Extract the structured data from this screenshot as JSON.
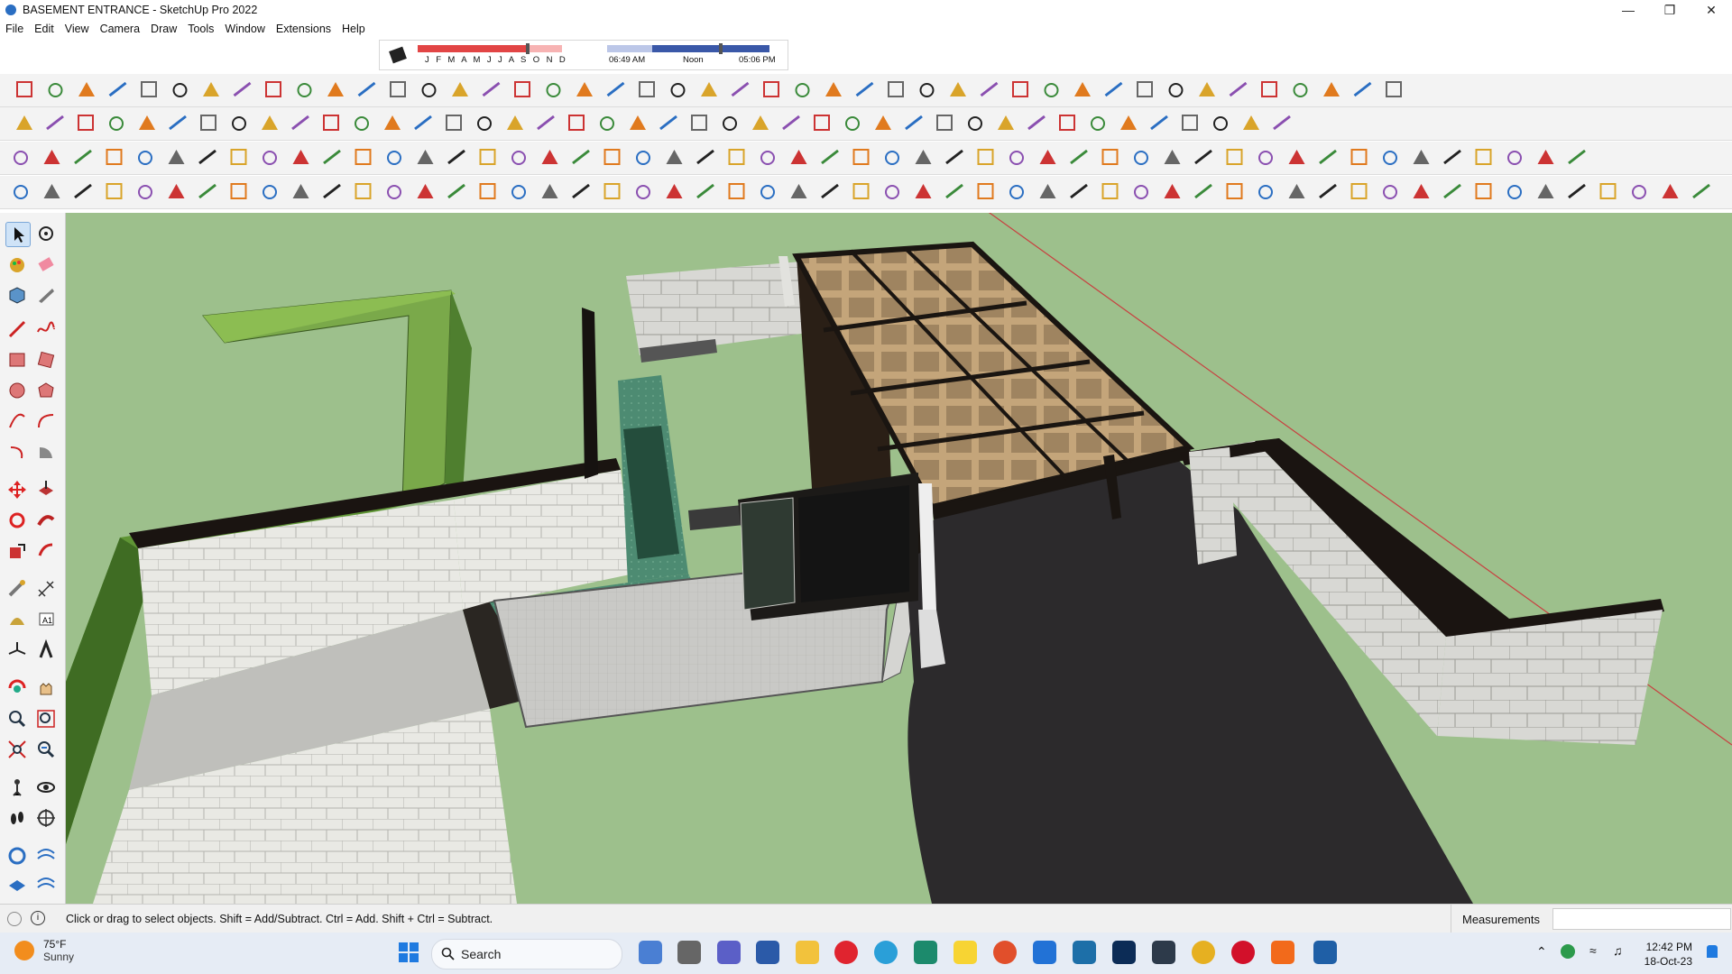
{
  "window": {
    "title": "BASEMENT ENTRANCE - SketchUp Pro 2022"
  },
  "menu": [
    "File",
    "Edit",
    "View",
    "Camera",
    "Draw",
    "Tools",
    "Window",
    "Extensions",
    "Help"
  ],
  "shadow": {
    "months": "J F M A M J J A S O N D",
    "time_start": "06:49 AM",
    "time_noon": "Noon",
    "time_end": "05:06 PM"
  },
  "status": {
    "hint": "Click or drag to select objects. Shift = Add/Subtract. Ctrl = Add. Shift + Ctrl = Subtract.",
    "measurements_label": "Measurements",
    "measurements_value": ""
  },
  "taskbar": {
    "weather_temp": "75°F",
    "weather_desc": "Sunny",
    "search_label": "Search",
    "time": "12:42 PM",
    "date": "18-Oct-23"
  }
}
